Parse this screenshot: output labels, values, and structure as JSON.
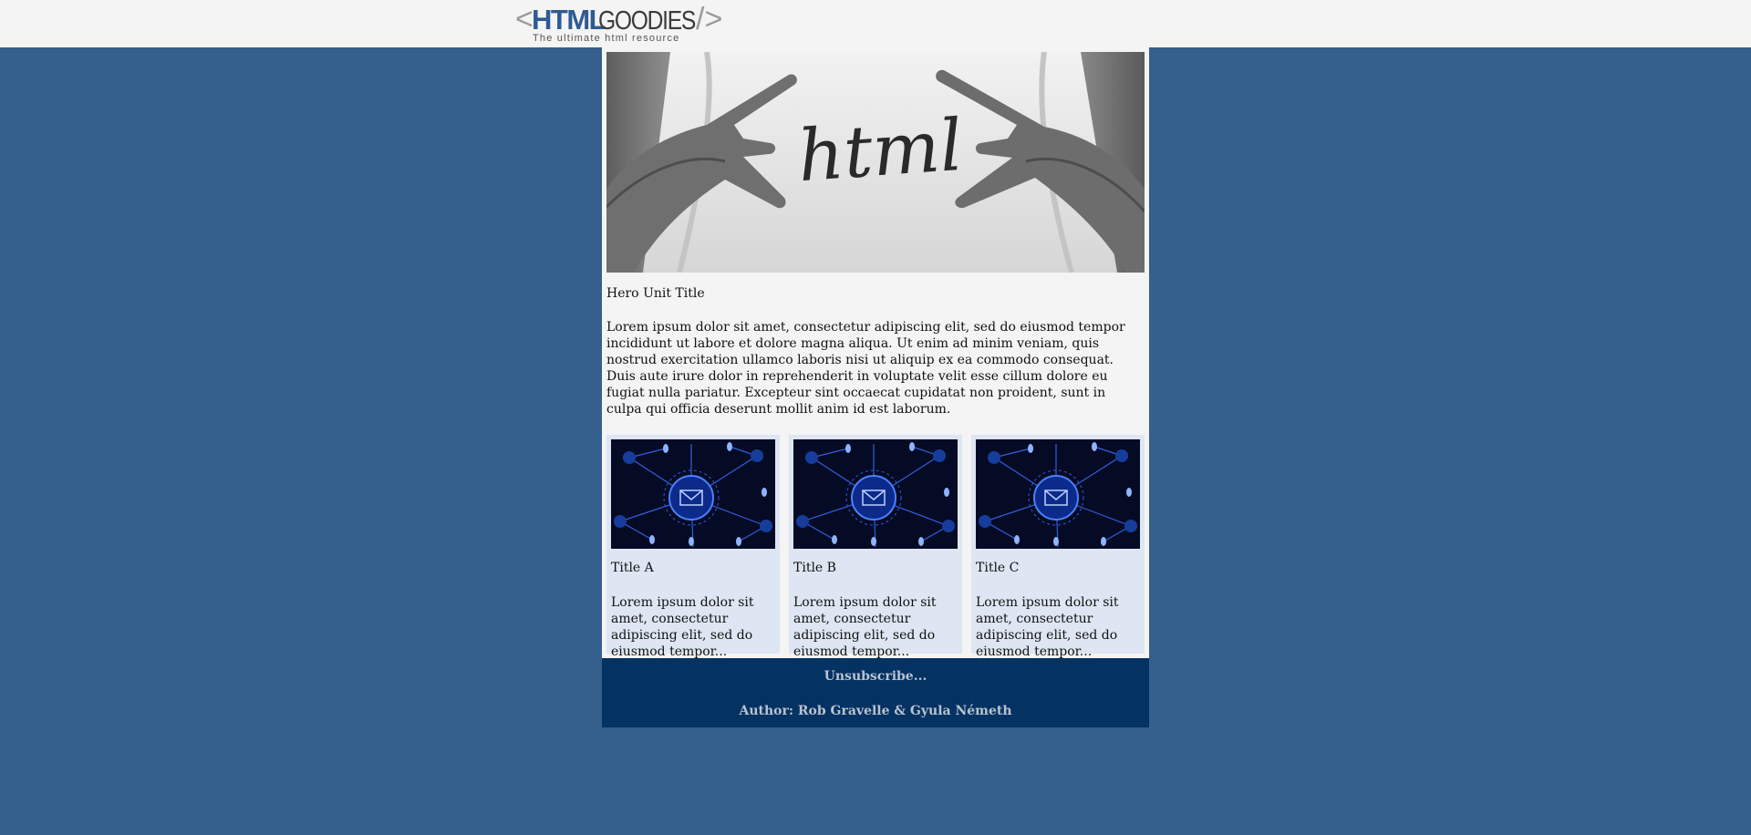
{
  "logo": {
    "left_bracket": "<",
    "brand_a": "HTML",
    "brand_b": "GOODIES",
    "right_bracket": "/>",
    "tagline": "The ultimate html resource",
    "accent": "#2e5b94"
  },
  "hero": {
    "image_text": "html",
    "title": "Hero Unit Title",
    "text": "Lorem ipsum dolor sit amet, consectetur adipiscing elit, sed do eiusmod tempor incididunt ut labore et dolore magna aliqua. Ut enim ad minim veniam, quis nostrud exercitation ullamco laboris nisi ut aliquip ex ea commodo consequat. Duis aute irure dolor in reprehenderit in voluptate velit esse cillum dolore eu fugiat nulla pariatur. Excepteur sint occaecat cupidatat non proident, sunt in culpa qui officia deserunt mollit anim id est laborum."
  },
  "cards": [
    {
      "title": "Title A",
      "text": "Lorem ipsum dolor sit amet, consectetur adipiscing elit, sed do eiusmod tempor..."
    },
    {
      "title": "Title B",
      "text": "Lorem ipsum dolor sit amet, consectetur adipiscing elit, sed do eiusmod tempor..."
    },
    {
      "title": "Title C",
      "text": "Lorem ipsum dolor sit amet, consectetur adipiscing elit, sed do eiusmod tempor..."
    }
  ],
  "footer": {
    "unsubscribe": "Unsubscribe...",
    "author": "Author: Rob Gravelle & Gyula Németh"
  },
  "colors": {
    "page_bg": "#355f8c",
    "footer_bg": "#033263",
    "card_bg": "#dde6f2"
  }
}
